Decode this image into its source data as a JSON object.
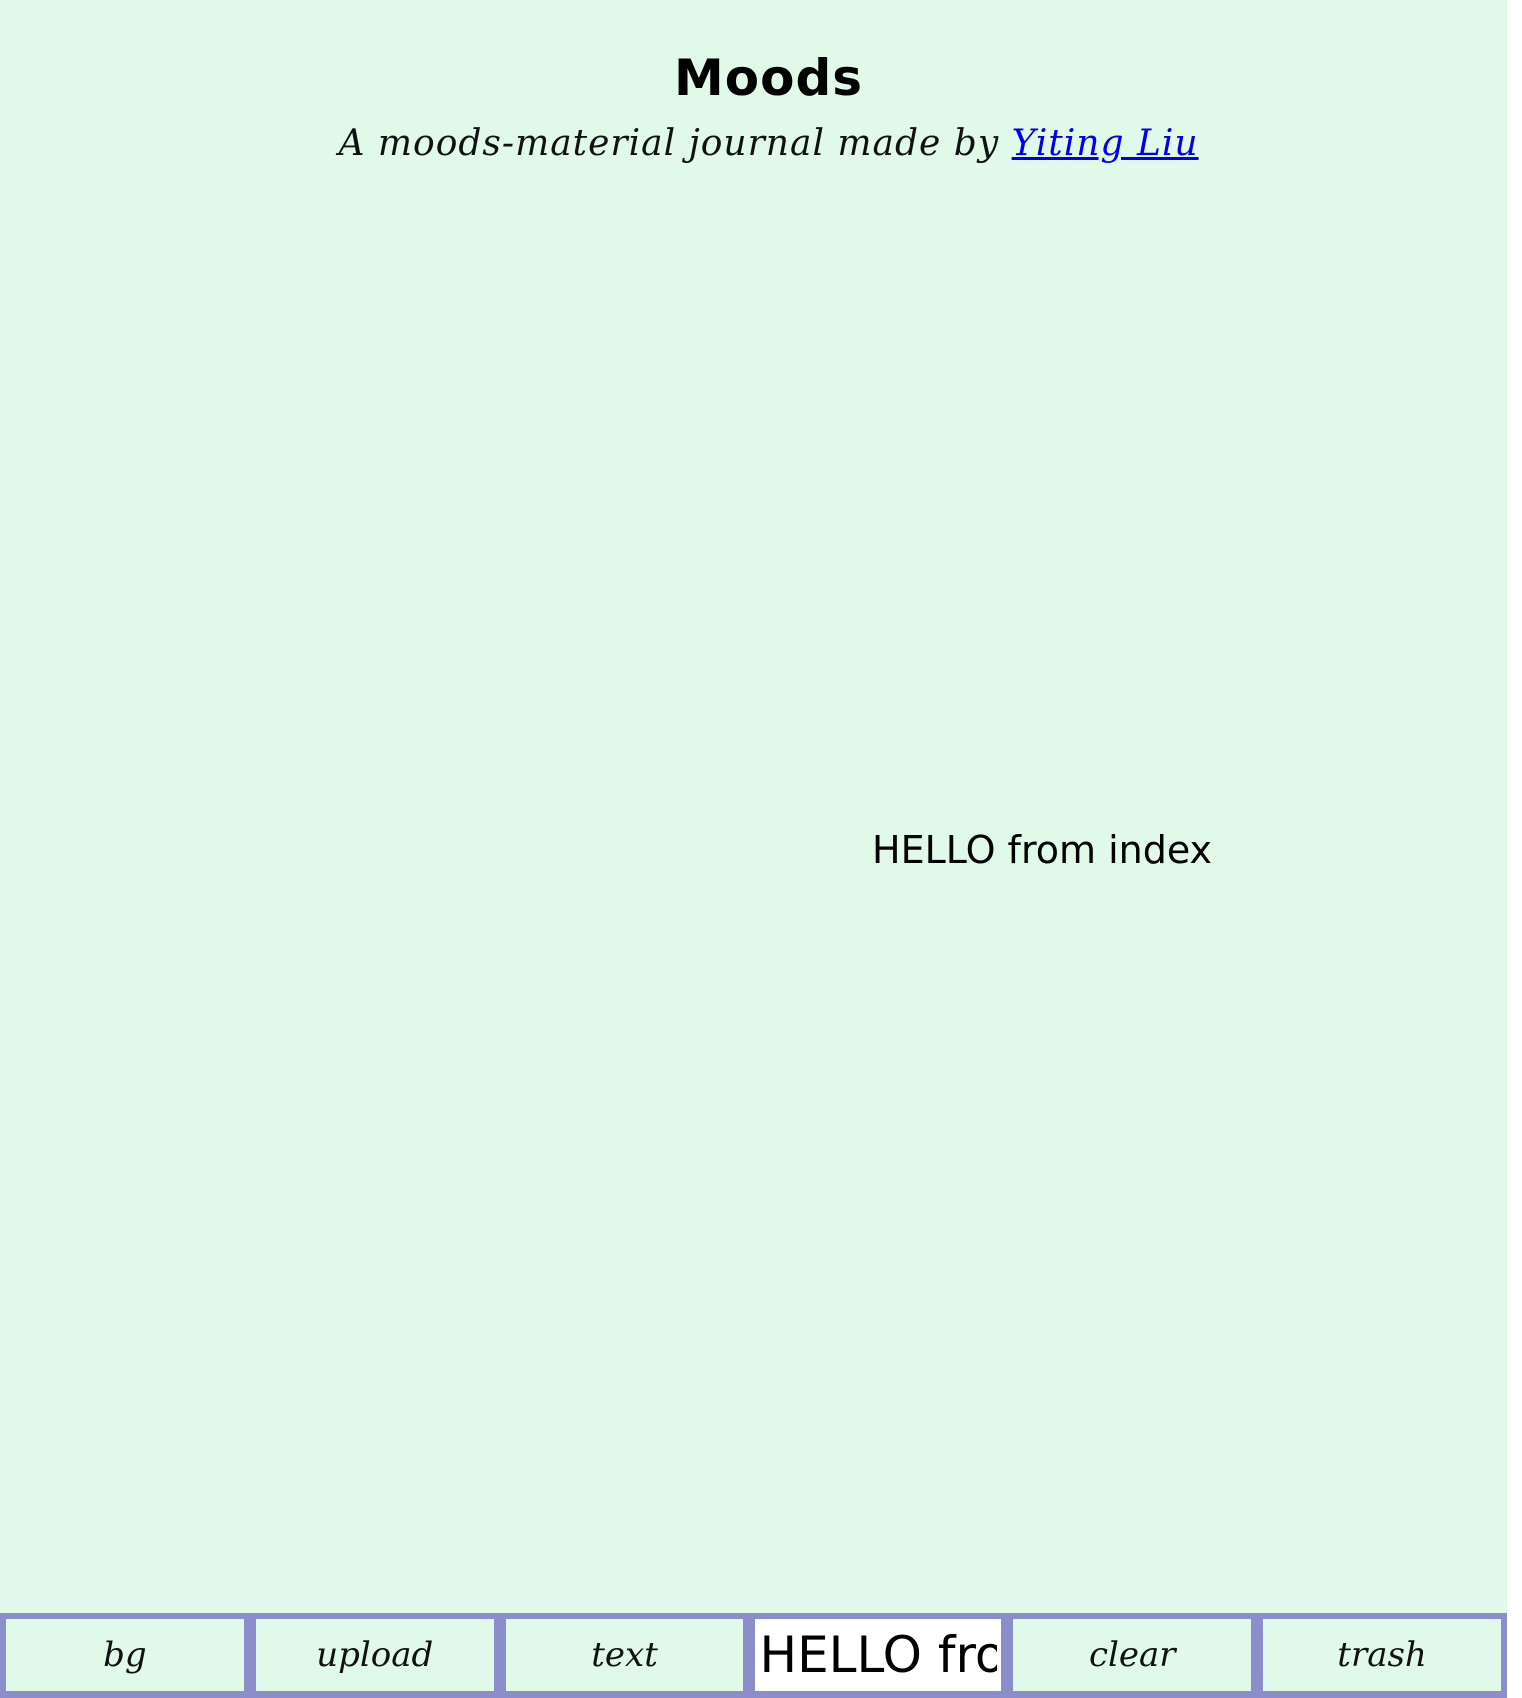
{
  "header": {
    "title": "Moods",
    "subtitle_prefix": "A moods-material journal made by ",
    "author_link": "Yiting Liu"
  },
  "board": {
    "mood_text": "HELLO from index"
  },
  "toolbar": {
    "bg_label": "bg",
    "upload_label": "upload",
    "text_label": "text",
    "text_input_value": "HELLO from index",
    "clear_label": "clear",
    "trash_label": "trash"
  },
  "colors": {
    "background": "#e0f9e9",
    "toolbar": "#8c8ecc",
    "link": "#0000ee"
  }
}
